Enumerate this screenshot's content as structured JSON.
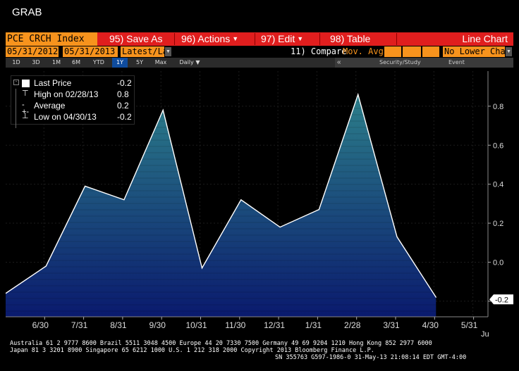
{
  "window": {
    "title": "GRAB"
  },
  "toolbar": {
    "ticker": "PCE CRCH Index",
    "save_as": "95) Save As",
    "actions": "96) Actions",
    "edit": "97) Edit",
    "table": "98) Table",
    "chart_type": "Line Chart"
  },
  "daterow": {
    "start_date": "05/31/2012",
    "end_date": "05/31/2013",
    "period": "Latest/Las",
    "compare": "11) Compare",
    "mov_avgs": "Mov. Avgs",
    "lower": "No Lower Char"
  },
  "rangebar": {
    "buttons": [
      "1D",
      "3D",
      "1M",
      "6M",
      "YTD",
      "1Y",
      "5Y",
      "Max"
    ],
    "active": "1Y",
    "frequency": "Daily",
    "collapse": "«",
    "security_tab": "Security/Study",
    "event_tab": "Event"
  },
  "legend": {
    "last_label": "Last Price",
    "last_value": "-0.2",
    "high_label": "High on 02/28/13",
    "high_value": "0.8",
    "avg_label": "Average",
    "avg_value": "0.2",
    "low_label": "Low on 04/30/13",
    "low_value": "-0.2"
  },
  "chart_data": {
    "type": "area",
    "x": [
      "5/31/12",
      "6/30/12",
      "7/31/12",
      "8/31/12",
      "9/30/12",
      "10/31/12",
      "11/30/12",
      "12/31/12",
      "1/31/13",
      "2/28/13",
      "3/31/13",
      "4/30/13"
    ],
    "values": [
      -0.16,
      -0.02,
      0.39,
      0.32,
      0.78,
      -0.03,
      0.32,
      0.18,
      0.27,
      0.86,
      0.13,
      -0.18
    ],
    "x_tick_labels": [
      "6/30",
      "7/31",
      "8/31",
      "9/30",
      "10/31",
      "11/30",
      "12/31",
      "1/31",
      "2/28",
      "3/31",
      "4/30",
      "5/31"
    ],
    "x_axis_extra": "Ju",
    "y_ticks": [
      0.8,
      0.6,
      0.4,
      0.2,
      0.0,
      -0.2
    ],
    "y_tick_labels": [
      "0.8",
      "0.6",
      "0.4",
      "0.2",
      "0.0",
      "-0.2"
    ],
    "ylim": [
      -0.28,
      0.98
    ],
    "last_value_label": "-0.2",
    "colors": {
      "line": "#ffffff",
      "fill_top": "#2c7f8a",
      "fill_bottom": "#0a1a6e",
      "background": "#000000"
    }
  },
  "footer": {
    "line1": "Australia 61 2 9777 8600 Brazil 5511 3048 4500 Europe 44 20 7330 7500 Germany 49 69 9204 1210 Hong Kong 852 2977 6000",
    "line2": "Japan 81 3 3201 8900       Singapore 65 6212 1000       U.S. 1 212 318 2000       Copyright 2013 Bloomberg Finance L.P.",
    "line3": "SN 355763 G597-1986-0 31-May-13 21:08:14 EDT  GMT-4:00"
  }
}
